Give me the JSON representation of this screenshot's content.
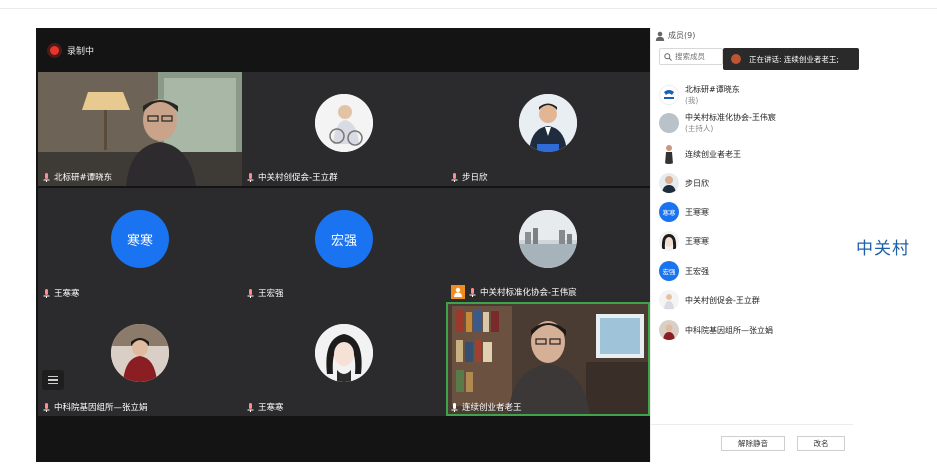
{
  "recording": {
    "label": "录制中"
  },
  "tiles": [
    {
      "name": "北标研#谭晓东",
      "avatar": "video-person"
    },
    {
      "name": "中关村创促会-王立群",
      "avatar": "photo"
    },
    {
      "name": "步日欣",
      "avatar": "photo"
    },
    {
      "name": "王寒寒",
      "avatar_text": "寒寒"
    },
    {
      "name": "王宏强",
      "avatar_text": "宏强"
    },
    {
      "name": "中关村标准化协会-王伟宸",
      "avatar": "photo"
    },
    {
      "name": "中科院基因组所—张立娟",
      "avatar": "photo"
    },
    {
      "name": "王寒寒",
      "avatar": "photo"
    },
    {
      "name": "连续创业者老王",
      "avatar": "video-person"
    }
  ],
  "panel": {
    "members_title": "成员(9)",
    "search_placeholder": "搜索成员",
    "speaking": "正在讲话: 连续创业者老王;",
    "members": [
      {
        "name": "北标研#谭晓东",
        "sub": "(我)"
      },
      {
        "name": "中关村标准化协会-王伟宸",
        "sub": "(主持人)"
      },
      {
        "name": "连续创业者老王",
        "sub": ""
      },
      {
        "name": "步日欣",
        "sub": ""
      },
      {
        "name": "王寒寒",
        "sub": "",
        "avatar_text": "寒寒"
      },
      {
        "name": "王寒寒",
        "sub": ""
      },
      {
        "name": "王宏强",
        "sub": "",
        "avatar_text": "宏强"
      },
      {
        "name": "中关村创促会-王立群",
        "sub": ""
      },
      {
        "name": "中科院基因组所—张立娟",
        "sub": ""
      }
    ],
    "unmute_all": "解除静音",
    "rename": "改名"
  },
  "brand_text": "中关村",
  "colors": {
    "accent_blue": "#1a73f0",
    "record_red": "#e8342b",
    "host_orange": "#f28c1a",
    "active_green": "#3ea34a"
  }
}
